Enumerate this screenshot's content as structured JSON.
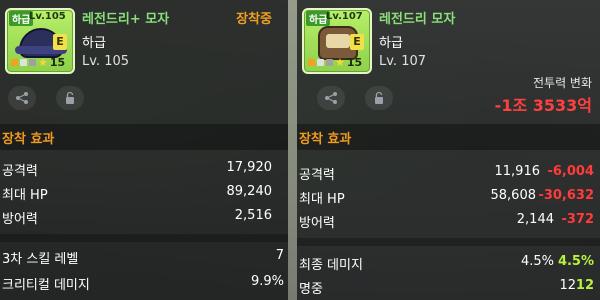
{
  "left": {
    "icon": {
      "grade_tag": "하급",
      "level_tag": "Lv.105",
      "potential_letter": "E",
      "star_count": "15",
      "pot_colors": [
        "#f4a020",
        "#e0e0e0",
        "#a0a0a0"
      ]
    },
    "name": "레전드리+ 모자",
    "equipped": "장착중",
    "grade": "하급",
    "level": "Lv. 105",
    "section_title": "장착 효과",
    "stats": [
      {
        "label": "공격력",
        "value": "17,920"
      },
      {
        "label": "최대 HP",
        "value": "89,240"
      },
      {
        "label": "방어력",
        "value": "2,516"
      }
    ],
    "skills": [
      {
        "label": "3차 스킬 레벨",
        "value": "7"
      },
      {
        "label": "크리티컬 데미지",
        "value": "9.9%"
      }
    ]
  },
  "right": {
    "icon": {
      "grade_tag": "하급",
      "level_tag": "Lv.107",
      "potential_letter": "E",
      "star_count": "15",
      "pot_colors": [
        "#f4a020",
        "#e0e0e0",
        "#a0a0a0"
      ]
    },
    "name": "레전드리 모자",
    "grade": "하급",
    "level": "Lv. 107",
    "power_label": "전투력 변화",
    "power_value": "-1조 3533억",
    "section_title": "장착 효과",
    "stats": [
      {
        "label": "공격력",
        "value": "11,916",
        "diff": "-6,004",
        "sign": "neg"
      },
      {
        "label": "최대 HP",
        "value": "58,608",
        "diff": "-30,632",
        "sign": "neg"
      },
      {
        "label": "방어력",
        "value": "2,144",
        "diff": "-372",
        "sign": "neg"
      }
    ],
    "skills": [
      {
        "label": "최종 데미지",
        "value": "4.5%",
        "diff": "4.5%",
        "sign": "pos"
      },
      {
        "label": "명중",
        "value": "12",
        "diff": "12",
        "sign": "pos"
      }
    ]
  },
  "icons": {
    "share": "share-icon",
    "lock": "lock-icon"
  }
}
